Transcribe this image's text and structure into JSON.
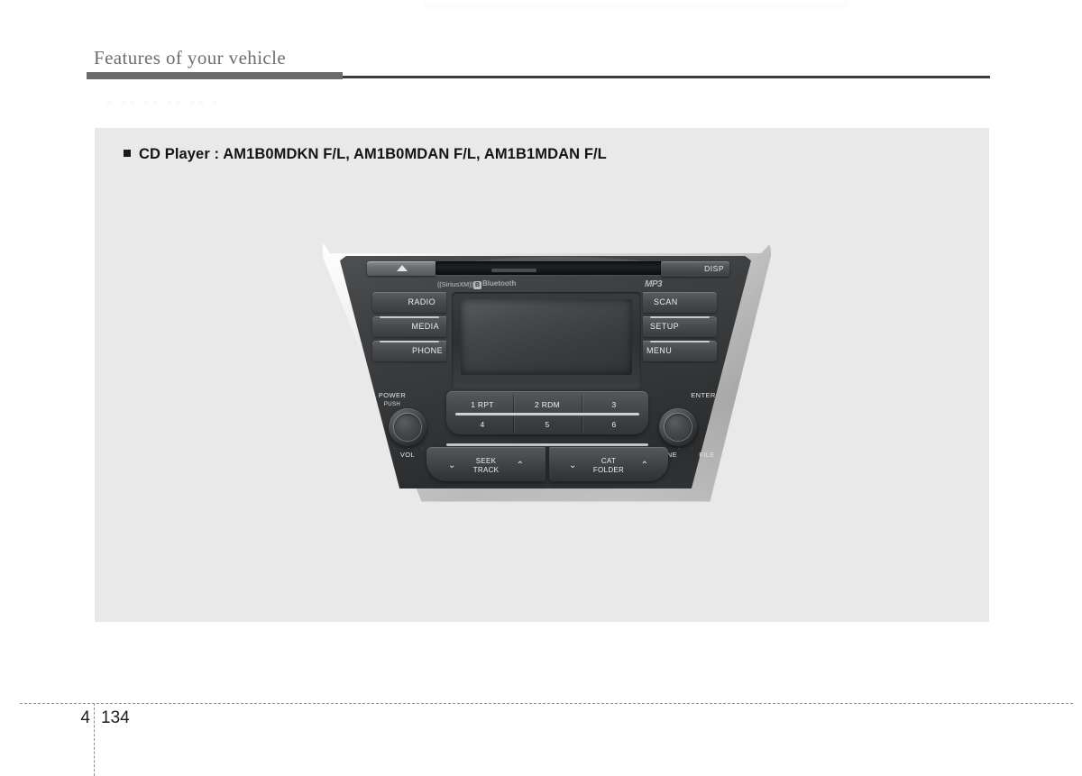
{
  "header": {
    "title": "Features of your vehicle",
    "ghost_artifact": "■ ■■ ■■ ■■ ■■ ■"
  },
  "section": {
    "bullet": "■",
    "heading": "CD Player : AM1B0MDKN F/L, AM1B0MDAN F/L, AM1B1MDAN F/L"
  },
  "head_unit": {
    "eject_button": {
      "name": "eject-button",
      "glyph": "▲"
    },
    "cd_slot_label": "CD slot",
    "disp_button": "DISP",
    "logos": {
      "siriusxm": "((SiriusXM))",
      "bluetooth_mark": "B",
      "bluetooth": "Bluetooth",
      "mp3": "MP3"
    },
    "left_buttons": [
      "RADIO",
      "MEDIA",
      "PHONE"
    ],
    "right_buttons": [
      "SCAN",
      "SETUP",
      "MENU"
    ],
    "left_knob": {
      "top_label_line1": "POWER",
      "top_label_line2": "PUSH",
      "bottom_label": "VOL",
      "ticks": "- - -"
    },
    "right_knob": {
      "top_label": "ENTER",
      "bottom_label_left": "TUNE",
      "bottom_label_right": "FILE",
      "ticks": "- - -"
    },
    "presets": {
      "row1": [
        "1 RPT",
        "2 RDM",
        "3"
      ],
      "row2": [
        "4",
        "5",
        "6"
      ]
    },
    "rocker_left": {
      "line1": "SEEK",
      "line2": "TRACK",
      "chevron_down": "⌄",
      "chevron_up": "⌃"
    },
    "rocker_right": {
      "line1": "CAT",
      "line2": "FOLDER",
      "chevron_down": "⌄",
      "chevron_up": "⌃"
    }
  },
  "footer": {
    "chapter": "4",
    "page": "134"
  },
  "colors": {
    "panel_background": "#e9e9e9",
    "header_rule": "#6b6b6b",
    "heading_text": "#141414",
    "bezel_silver": "#d8d8d8",
    "face_dark": "#3a3c3e"
  }
}
